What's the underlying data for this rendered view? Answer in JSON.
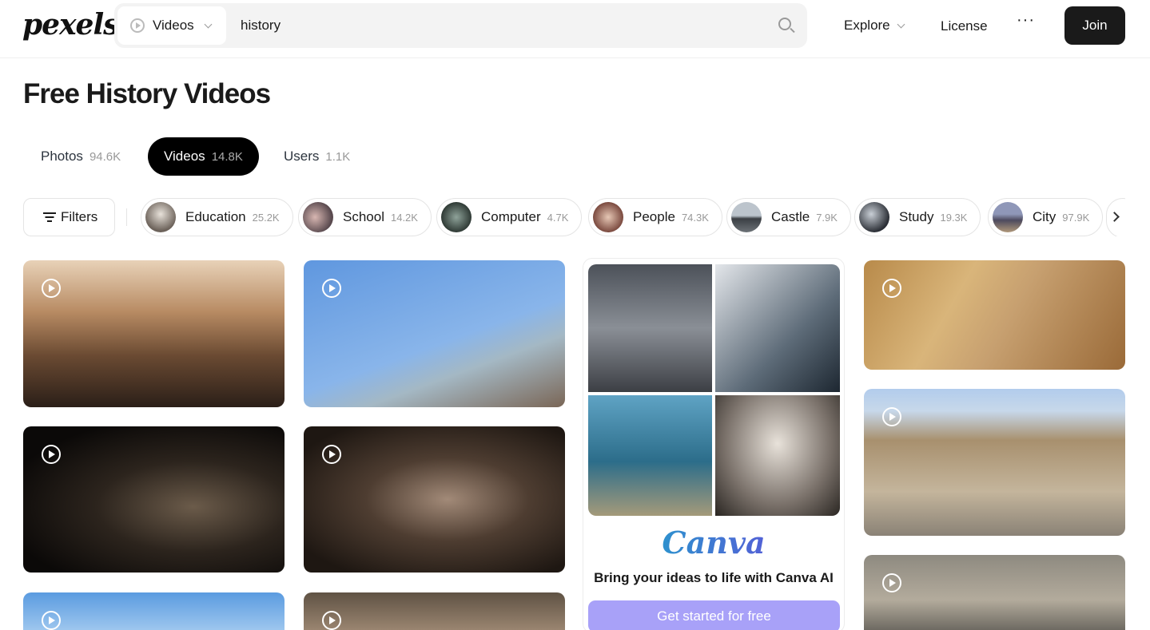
{
  "header": {
    "logo": "pexels",
    "search_type": "Videos",
    "search_value": "history",
    "nav_explore": "Explore",
    "nav_license": "License",
    "nav_more": "···",
    "join_label": "Join"
  },
  "page": {
    "title": "Free History Videos"
  },
  "tabs": [
    {
      "label": "Photos",
      "count": "94.6K"
    },
    {
      "label": "Videos",
      "count": "14.8K"
    },
    {
      "label": "Users",
      "count": "1.1K"
    }
  ],
  "filters_label": "Filters",
  "chips": [
    {
      "label": "Education",
      "count": "25.2K"
    },
    {
      "label": "School",
      "count": "14.2K"
    },
    {
      "label": "Computer",
      "count": "4.7K"
    },
    {
      "label": "People",
      "count": "74.3K"
    },
    {
      "label": "Castle",
      "count": "7.9K"
    },
    {
      "label": "Study",
      "count": "19.3K"
    },
    {
      "label": "City",
      "count": "97.9K"
    }
  ],
  "ad": {
    "brand": "Canva",
    "headline": "Bring your ideas to life with Canva AI",
    "cta": "Get started for free"
  },
  "colors": {
    "accent_dark": "#000000",
    "ad_cta": "#a8a1f8"
  }
}
